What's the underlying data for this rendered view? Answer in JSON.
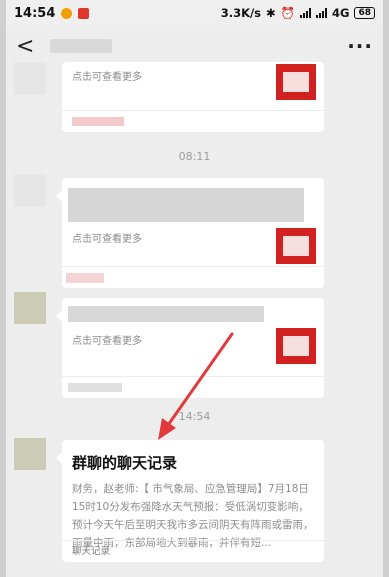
{
  "status_bar": {
    "time": "14:54",
    "net_speed": "3.3K/s",
    "network": "4G",
    "battery": "68"
  },
  "header": {
    "back_glyph": "<",
    "menu_glyph": "···"
  },
  "messages": [
    {
      "label": "点击可查看更多"
    },
    {
      "time": "08:11",
      "label": "点击可查看更多"
    },
    {
      "label": "点击可查看更多"
    },
    {
      "time": "14:54",
      "title": "群聊的聊天记录",
      "body": "财务，赵老师:【        市气象局、应急管理局】7月18日15时10分发布强降水天气预报：受低涡切变影响，预计今天午后至明天我市多云间阴天有阵雨或雷雨，雨量中雨，东部局地大到暴雨，并伴有短...",
      "footer": "聊天记录"
    }
  ],
  "colors": {
    "thumb_red": "#d22121",
    "arrow_red": "#e23a3a"
  }
}
